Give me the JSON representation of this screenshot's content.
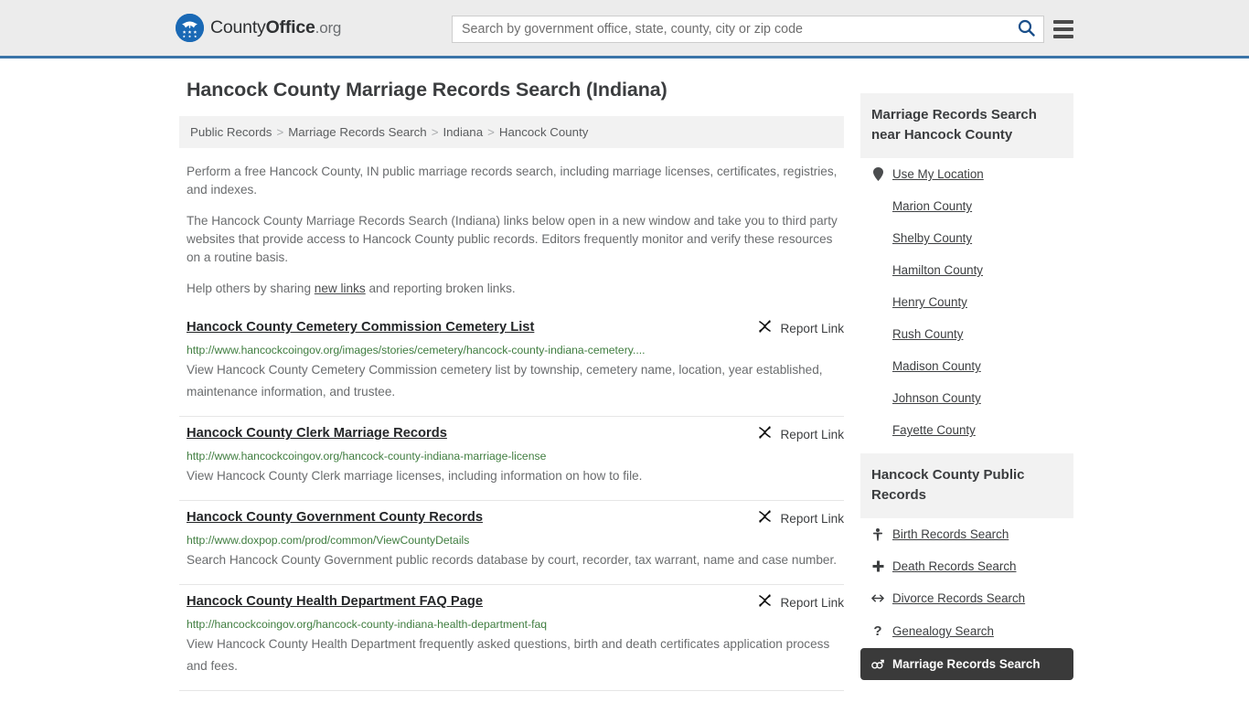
{
  "header": {
    "logo": {
      "icon": "eagle-shield-logo-icon",
      "text_part1": "County",
      "text_part2": "Office",
      "text_part3": ".org"
    },
    "search": {
      "placeholder": "Search by government office, state, county, city or zip code",
      "value": "",
      "search_icon": "search-icon"
    },
    "menu_icon": "hamburger-menu-icon",
    "accent_color": "#3b74a8"
  },
  "page": {
    "title": "Hancock County Marriage Records Search (Indiana)"
  },
  "breadcrumb": {
    "separator": ">",
    "items": [
      {
        "label": "Public Records"
      },
      {
        "label": "Marriage Records Search"
      },
      {
        "label": "Indiana"
      },
      {
        "label": "Hancock County"
      }
    ]
  },
  "intro": {
    "paragraph1": "Perform a free Hancock County, IN public marriage records search, including marriage licenses, certificates, registries, and indexes.",
    "paragraph2": "The Hancock County Marriage Records Search (Indiana) links below open in a new window and take you to third party websites that provide access to Hancock County public records. Editors frequently monitor and verify these resources on a routine basis.",
    "paragraph3_before": "Help others by sharing ",
    "paragraph3_link": "new links",
    "paragraph3_after": " and reporting broken links."
  },
  "results": {
    "report_label": "Report Link",
    "report_icon": "broken-link-icon",
    "items": [
      {
        "title": "Hancock County Cemetery Commission Cemetery List",
        "url": "http://www.hancockcoingov.org/images/stories/cemetery/hancock-county-indiana-cemetery....",
        "description": "View Hancock County Cemetery Commission cemetery list by township, cemetery name, location, year established, maintenance information, and trustee."
      },
      {
        "title": "Hancock County Clerk Marriage Records",
        "url": "http://www.hancockcoingov.org/hancock-county-indiana-marriage-license",
        "description": "View Hancock County Clerk marriage licenses, including information on how to file."
      },
      {
        "title": "Hancock County Government County Records",
        "url": "http://www.doxpop.com/prod/common/ViewCountyDetails",
        "description": "Search Hancock County Government public records database by court, recorder, tax warrant, name and case number."
      },
      {
        "title": "Hancock County Health Department FAQ Page",
        "url": "http://hancockcoingov.org/hancock-county-indiana-health-department-faq",
        "description": "View Hancock County Health Department frequently asked questions, birth and death certificates application process and fees."
      }
    ]
  },
  "sidebar": {
    "nearby": {
      "heading": "Marriage Records Search near Hancock County",
      "use_my_location": {
        "label": "Use My Location",
        "icon": "map-pin-icon"
      },
      "counties": [
        {
          "label": "Marion County"
        },
        {
          "label": "Shelby County"
        },
        {
          "label": "Hamilton County"
        },
        {
          "label": "Henry County"
        },
        {
          "label": "Rush County"
        },
        {
          "label": "Madison County"
        },
        {
          "label": "Johnson County"
        },
        {
          "label": "Fayette County"
        }
      ]
    },
    "public_records": {
      "heading": "Hancock County Public Records",
      "items": [
        {
          "label": "Birth Records Search",
          "icon": "baby-icon",
          "glyph": "Ŧ",
          "active": false
        },
        {
          "label": "Death Records Search",
          "icon": "cross-icon",
          "glyph": "✚",
          "active": false
        },
        {
          "label": "Divorce Records Search",
          "icon": "arrows-left-right-icon",
          "glyph": "↔",
          "active": false
        },
        {
          "label": "Genealogy Search",
          "icon": "question-mark-icon",
          "glyph": "?",
          "active": false
        },
        {
          "label": "Marriage Records Search",
          "icon": "male-female-icon",
          "glyph": "⚥",
          "active": true
        }
      ]
    }
  }
}
